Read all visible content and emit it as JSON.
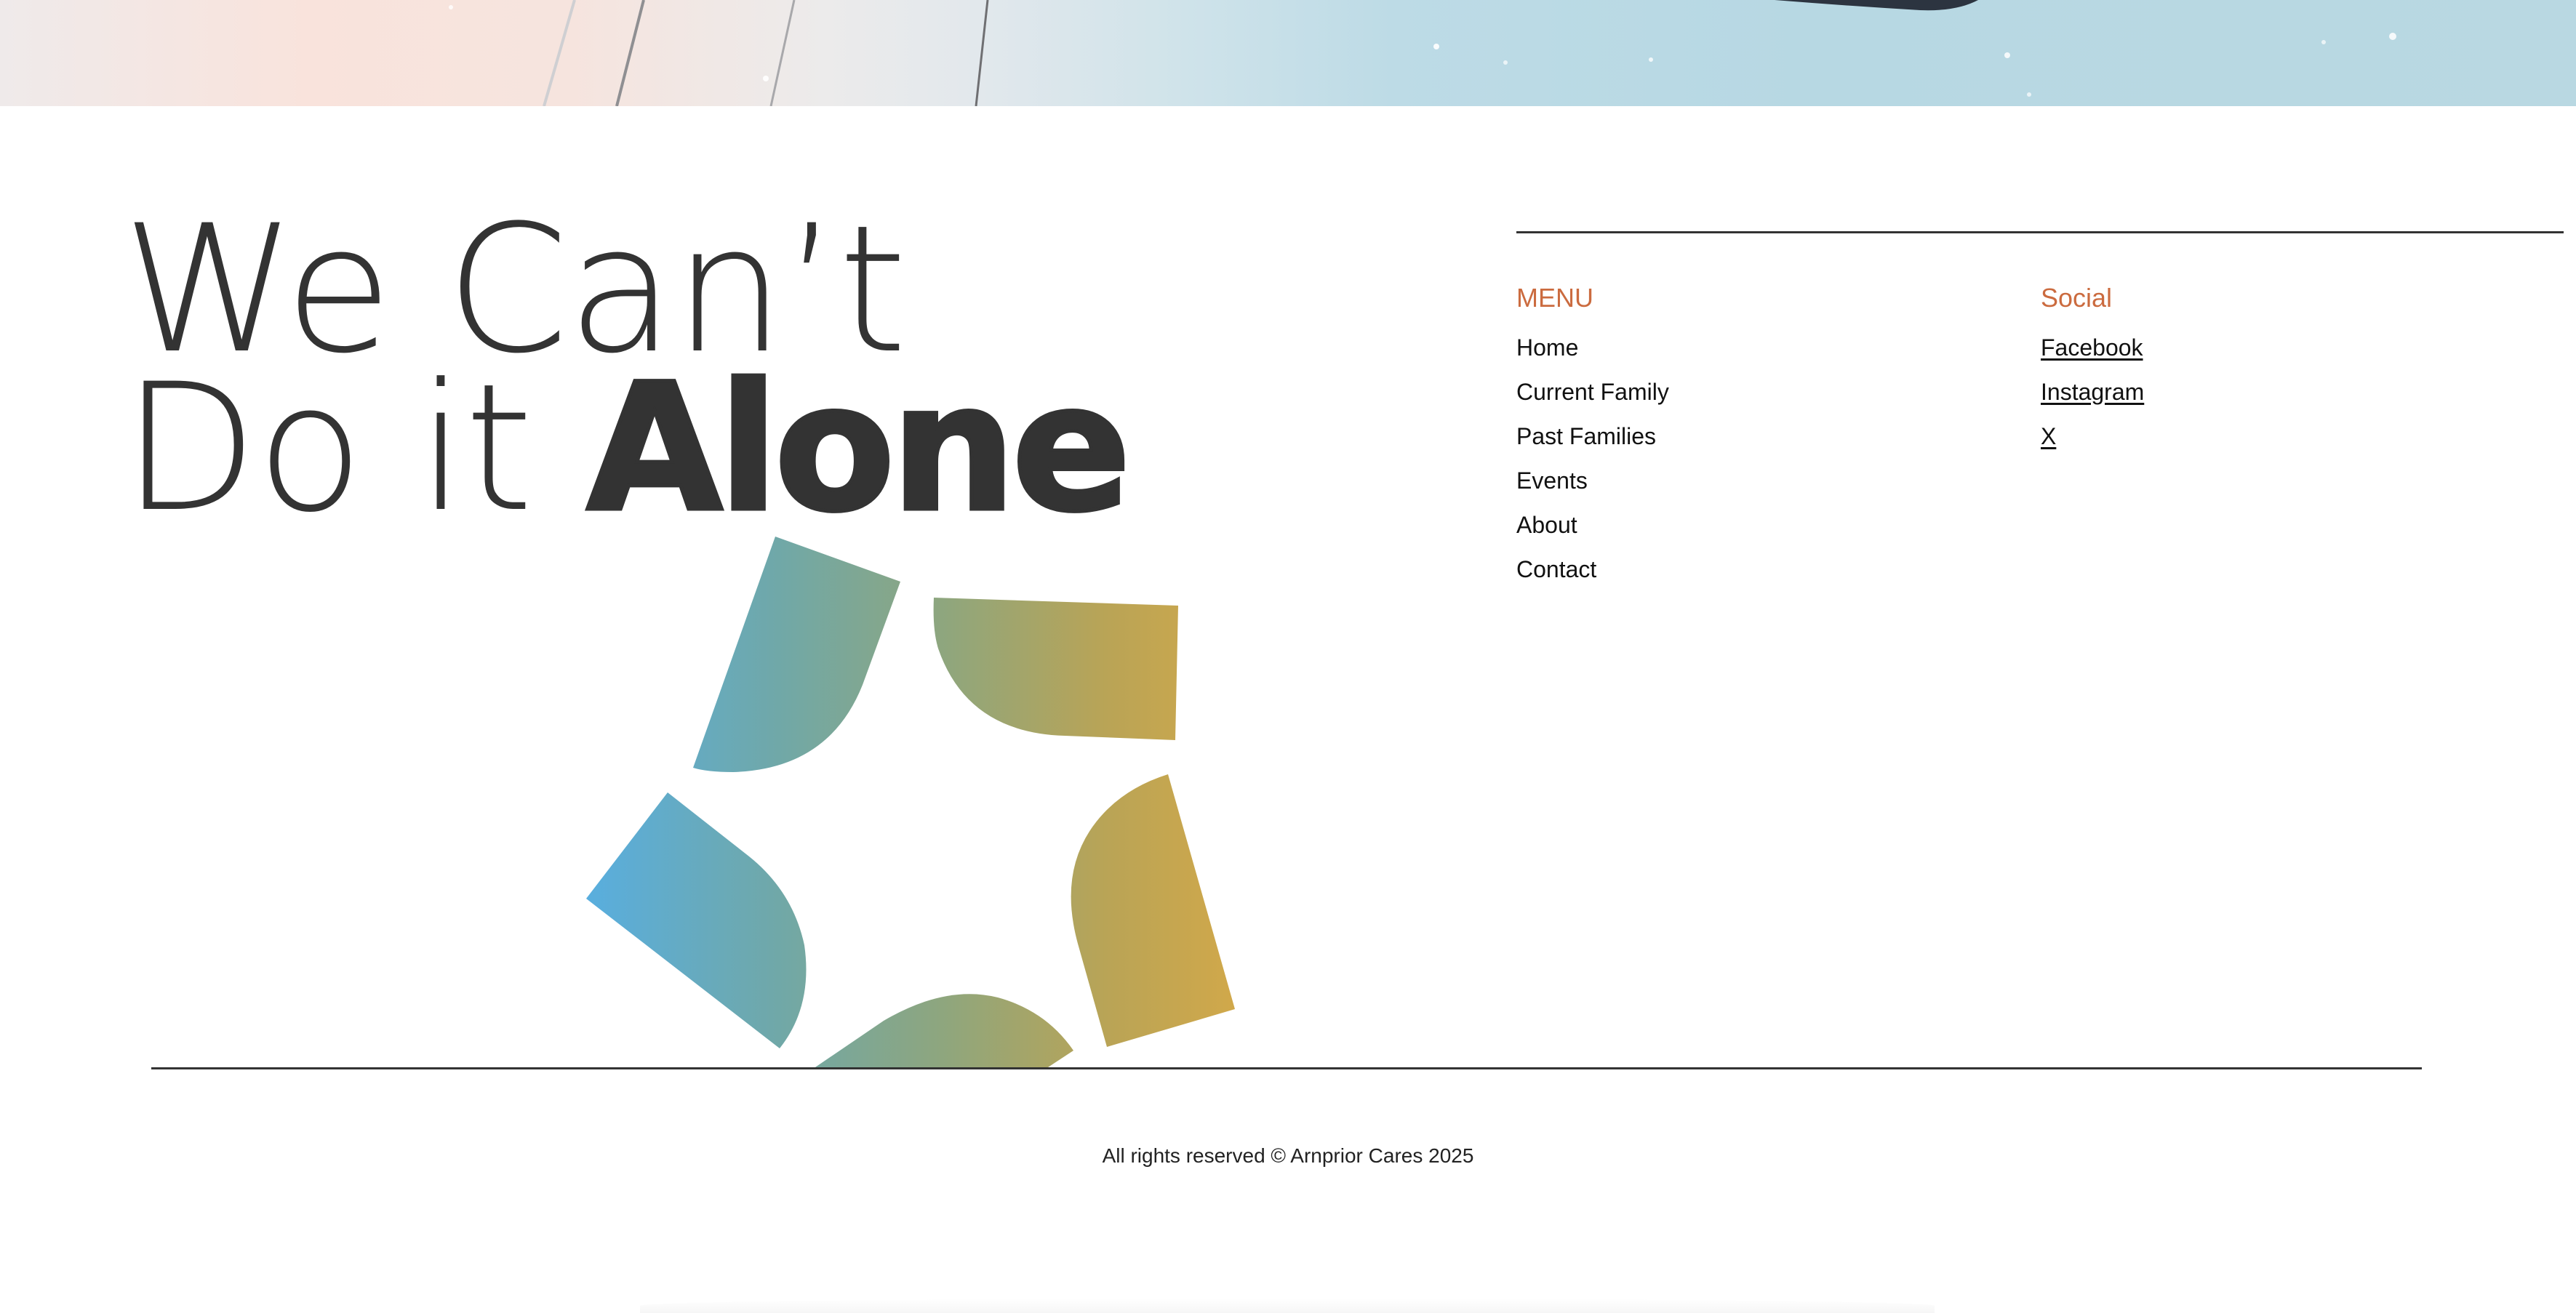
{
  "headline": {
    "line1": "We Can’t",
    "line2_thin": "Do it ",
    "line2_bold": "Alone"
  },
  "footer_nav": {
    "menu": {
      "heading": "MENU",
      "items": [
        "Home",
        "Current Family",
        "Past Families",
        "Events",
        "About",
        "Contact"
      ]
    },
    "social": {
      "heading": "Social",
      "items": [
        "Facebook",
        "Instagram",
        "X"
      ]
    }
  },
  "copyright": "All rights reserved © Arnprior Cares 2025",
  "colors": {
    "accent": "#cb6b3f",
    "text": "#333333",
    "logo_gradient_start": "#58aee0",
    "logo_gradient_mid": "#8ea67e",
    "logo_gradient_end": "#d1a84a"
  },
  "icons": {
    "logo": "star-logo-icon"
  }
}
